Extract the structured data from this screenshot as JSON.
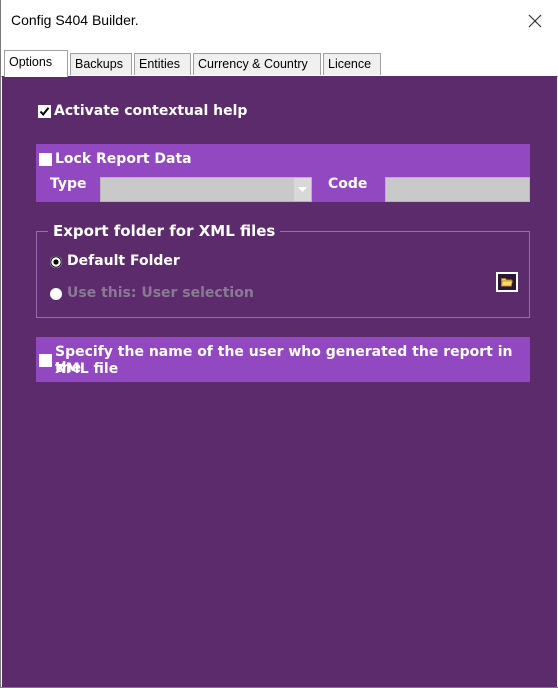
{
  "window": {
    "title": "Config S404 Builder."
  },
  "tabs": [
    {
      "label": "Options",
      "active": true
    },
    {
      "label": "Backups",
      "active": false
    },
    {
      "label": "Entities",
      "active": false
    },
    {
      "label": "Currency & Country",
      "active": false
    },
    {
      "label": "Licence",
      "active": false
    }
  ],
  "options": {
    "contextual_help": {
      "label": "Activate contextual help",
      "checked": true
    },
    "lock_report": {
      "label": "Lock Report Data",
      "checked": false,
      "type_label": "Type",
      "type_value": "",
      "code_label": "Code",
      "code_value": ""
    },
    "export": {
      "group_label": "Export folder for XML files",
      "default_label": "Default Folder",
      "default_selected": true,
      "custom_label": "Use this: User selection",
      "custom_enabled": false
    },
    "user_name": {
      "label_line1": "Specify the name of the user who generated the report in the",
      "label_line2": "XML file",
      "checked": false
    }
  },
  "colors": {
    "panel_bg": "#5c2b6b",
    "band_bg": "#9248c0",
    "input_bg": "#c9c9c9",
    "disabled_text": "#8a7a96"
  }
}
